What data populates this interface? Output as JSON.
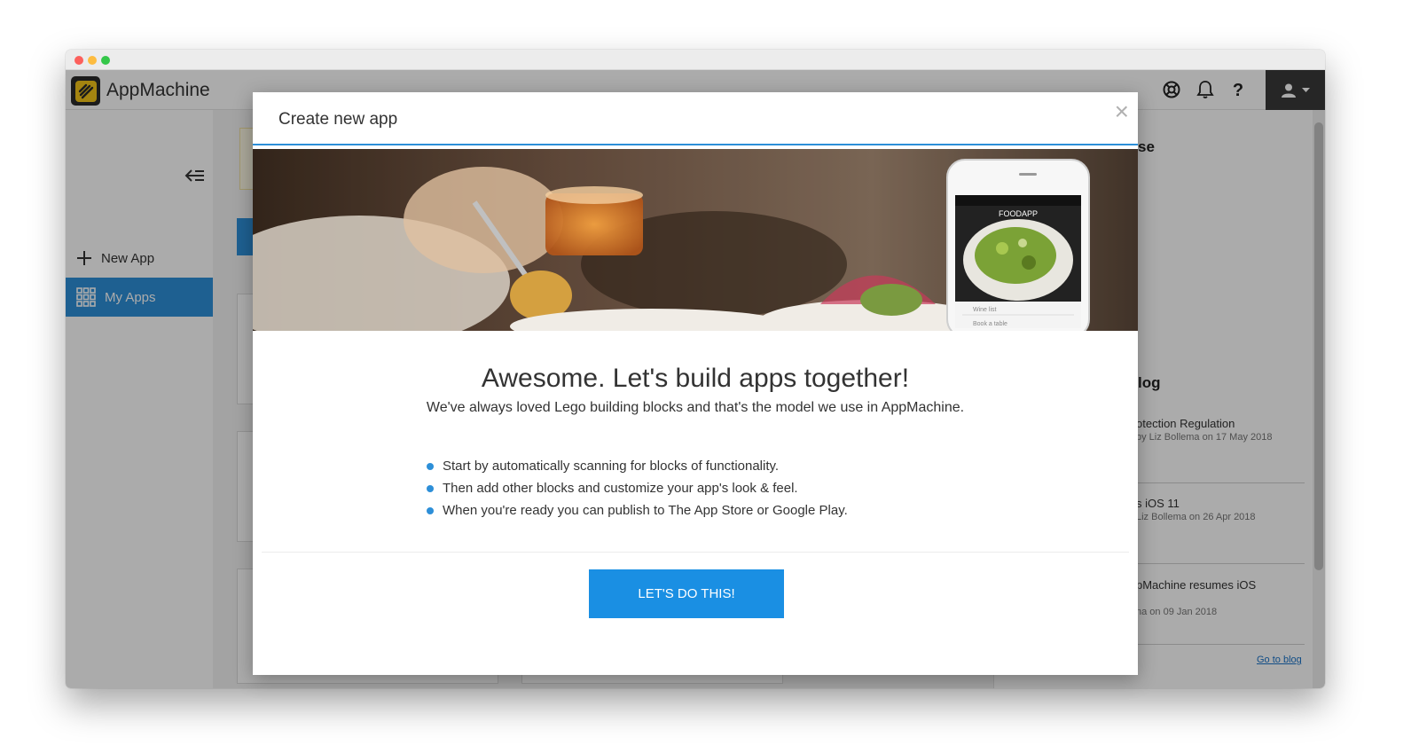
{
  "app": {
    "brand": "AppMachine"
  },
  "header": {
    "icons": [
      "lifebuoy-icon",
      "bell-icon",
      "help-icon",
      "user-icon"
    ],
    "help_glyph": "?"
  },
  "sidebar": {
    "items": [
      {
        "label": "New App",
        "icon": "plus-icon"
      },
      {
        "label": "My Apps",
        "icon": "grid-icon",
        "active": true
      }
    ]
  },
  "blog": {
    "title_partial": "log",
    "section_partial": "se",
    "posts": [
      {
        "title": "otection Regulation",
        "meta": "by Liz Bollema on 17 May 2018"
      },
      {
        "title": "s iOS 11",
        "meta": "Liz Bollema on 26 Apr 2018"
      },
      {
        "title": "pMachine resumes iOS",
        "meta": "na on 09 Jan 2018"
      }
    ],
    "link": "Go to blog"
  },
  "modal": {
    "title": "Create new app",
    "close_glyph": "×",
    "phone_app_name": "FOODAPP",
    "phone_menu": [
      "Wine list",
      "Book a table"
    ],
    "heading": "Awesome. Let's build apps together!",
    "subheading": "We've always loved Lego building blocks and that's the model we use in AppMachine.",
    "bullets": [
      "Start by automatically scanning for blocks of functionality.",
      "Then add other blocks and customize your app's look & feel.",
      "When you're ready you can publish to The App Store or Google Play."
    ],
    "cta_label": "LET'S DO THIS!"
  },
  "colors": {
    "accent": "#2d8fd8",
    "cta": "#1a8fe3",
    "logo_yellow": "#f5c518"
  }
}
